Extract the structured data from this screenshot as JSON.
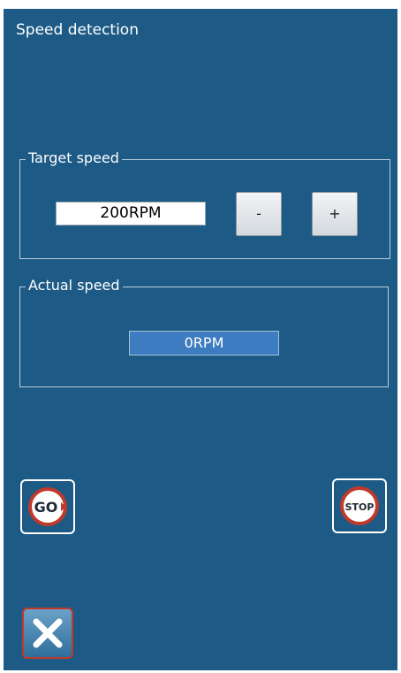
{
  "header": {
    "title": "Speed detection"
  },
  "target": {
    "label": "Target speed",
    "value": "200RPM",
    "minus_label": "-",
    "plus_label": "+"
  },
  "actual": {
    "label": "Actual speed",
    "value": "0RPM"
  },
  "buttons": {
    "go_icon_text": "GO",
    "stop_icon_text": "STOP"
  },
  "colors": {
    "background": "#1d5a85",
    "actual_field": "#3d7cc0",
    "button_red": "#c1392b"
  },
  "icons": [
    "go-icon",
    "stop-icon",
    "close-icon"
  ]
}
